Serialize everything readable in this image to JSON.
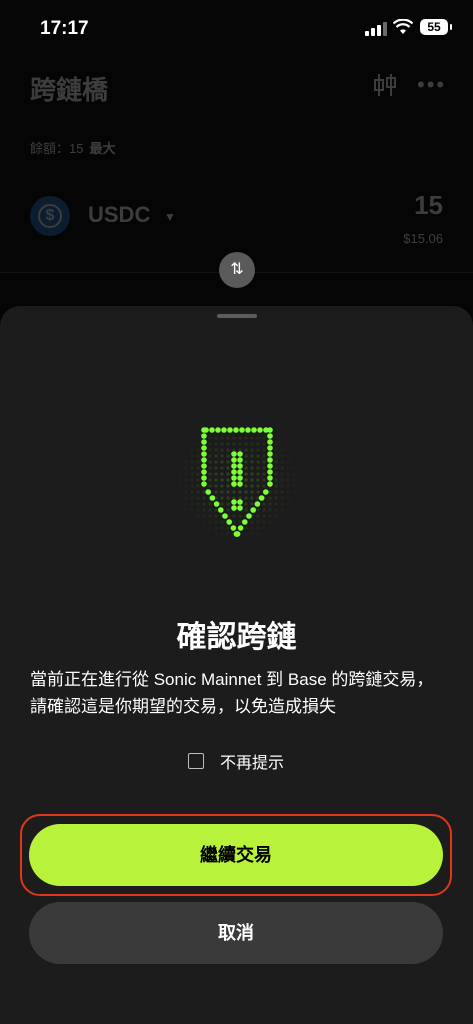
{
  "status_bar": {
    "time": "17:17",
    "battery": "55"
  },
  "header": {
    "title": "跨鏈橋"
  },
  "balance": {
    "label": "餘額：15",
    "max_label": "最大"
  },
  "token": {
    "symbol": "USDC",
    "logo_glyph": "$",
    "amount": "15",
    "usd_value": "$15.06"
  },
  "swap_icon": "⇅",
  "sheet": {
    "title": "確認跨鏈",
    "description": "當前正在進行從 Sonic Mainnet 到 Base 的跨鏈交易，請確認這是你期望的交易，以免造成損失",
    "dont_show_label": "不再提示",
    "dont_show_checked": false,
    "continue_label": "繼續交易",
    "cancel_label": "取消"
  },
  "colors": {
    "accent": "#b8f23a",
    "shield": "#7cff3a",
    "focus_ring": "#e0361c",
    "sheet_bg": "#1c1c1c"
  },
  "icons": [
    "shield-warning-icon",
    "swap-arrows-icon",
    "more-icon",
    "settings-sliders-icon",
    "usdc-logo",
    "chevron-down-icon"
  ]
}
